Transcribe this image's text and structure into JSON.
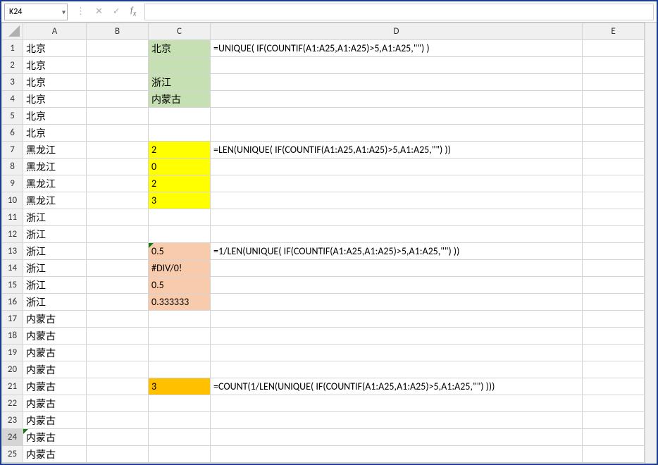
{
  "namebox": {
    "value": "K24"
  },
  "formula_bar": {
    "value": ""
  },
  "columns": [
    "A",
    "B",
    "C",
    "D",
    "E"
  ],
  "rows": [
    {
      "num": "1",
      "A": "北京",
      "C": "北京",
      "C_bg": "bg-green",
      "D": "=UNIQUE( IF(COUNTIF(A1:A25,A1:A25)>5,A1:A25,\"\") )"
    },
    {
      "num": "2",
      "A": "北京",
      "C": "",
      "C_bg": "bg-green"
    },
    {
      "num": "3",
      "A": "北京",
      "C": "浙江",
      "C_bg": "bg-green"
    },
    {
      "num": "4",
      "A": "北京",
      "C": "内蒙古",
      "C_bg": "bg-green"
    },
    {
      "num": "5",
      "A": "北京"
    },
    {
      "num": "6",
      "A": "北京"
    },
    {
      "num": "7",
      "A": "黑龙江",
      "C": "2",
      "C_bg": "bg-yellow",
      "C_align": "align-right",
      "D": "=LEN(UNIQUE( IF(COUNTIF(A1:A25,A1:A25)>5,A1:A25,\"\") ))"
    },
    {
      "num": "8",
      "A": "黑龙江",
      "C": "0",
      "C_bg": "bg-yellow",
      "C_align": "align-right"
    },
    {
      "num": "9",
      "A": "黑龙江",
      "C": "2",
      "C_bg": "bg-yellow",
      "C_align": "align-right"
    },
    {
      "num": "10",
      "A": "黑龙江",
      "C": "3",
      "C_bg": "bg-yellow",
      "C_align": "align-right"
    },
    {
      "num": "11",
      "A": "浙江"
    },
    {
      "num": "12",
      "A": "浙江"
    },
    {
      "num": "13",
      "A": "浙江",
      "C": "0.5",
      "C_bg": "bg-peach",
      "C_align": "align-right",
      "C_tri": true,
      "D": "=1/LEN(UNIQUE( IF(COUNTIF(A1:A25,A1:A25)>5,A1:A25,\"\") ))"
    },
    {
      "num": "14",
      "A": "浙江",
      "C": "#DIV/0!",
      "C_bg": "bg-peach"
    },
    {
      "num": "15",
      "A": "浙江",
      "C": "0.5",
      "C_bg": "bg-peach",
      "C_align": "align-right"
    },
    {
      "num": "16",
      "A": "浙江",
      "C": "0.333333",
      "C_bg": "bg-peach",
      "C_align": "align-right"
    },
    {
      "num": "17",
      "A": "内蒙古"
    },
    {
      "num": "18",
      "A": "内蒙古"
    },
    {
      "num": "19",
      "A": "内蒙古"
    },
    {
      "num": "20",
      "A": "内蒙古"
    },
    {
      "num": "21",
      "A": "内蒙古",
      "C": "3",
      "C_bg": "bg-orange",
      "C_align": "align-center",
      "D": "=COUNT(1/LEN(UNIQUE( IF(COUNTIF(A1:A25,A1:A25)>5,A1:A25,\"\") )))"
    },
    {
      "num": "22",
      "A": "内蒙古"
    },
    {
      "num": "23",
      "A": "内蒙古"
    },
    {
      "num": "24",
      "A": "内蒙古",
      "A_tri": true,
      "row_active": true
    },
    {
      "num": "25",
      "A": "内蒙古",
      "partial": true
    }
  ]
}
